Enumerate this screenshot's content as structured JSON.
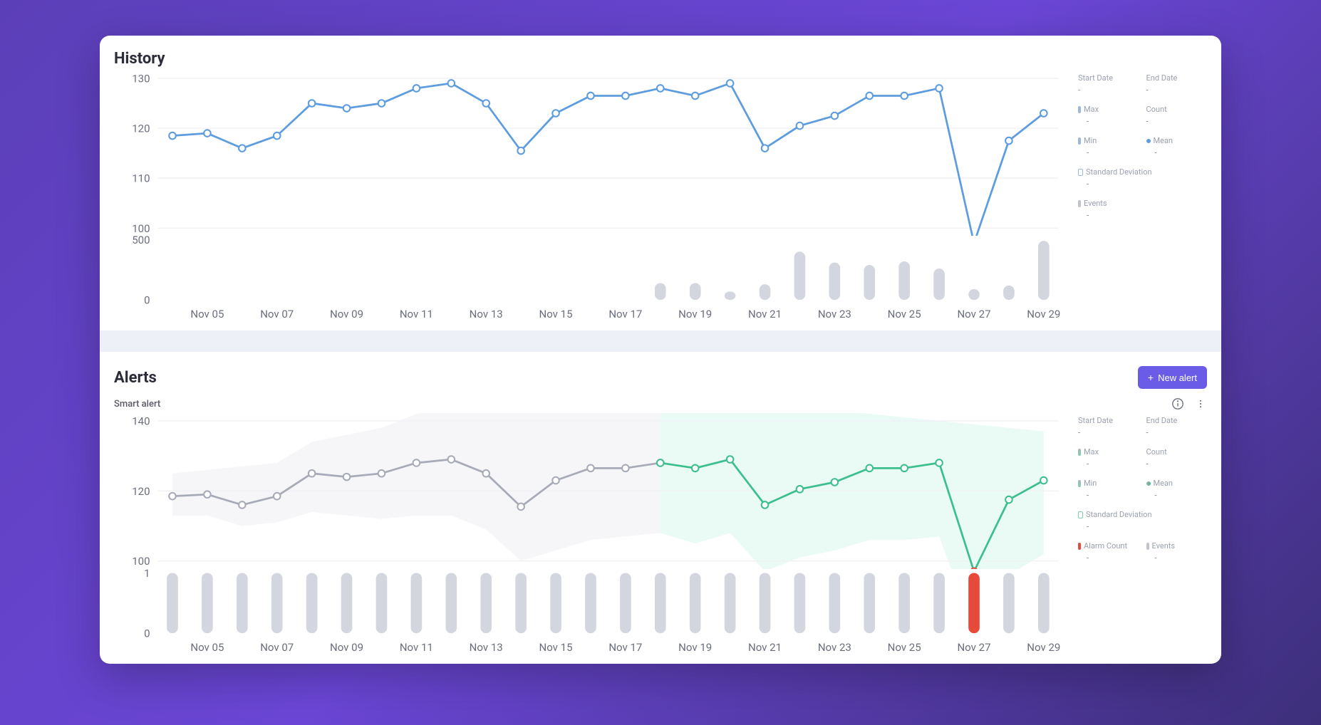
{
  "history": {
    "title": "History",
    "info": {
      "start_date": {
        "label": "Start Date",
        "value": "-"
      },
      "end_date": {
        "label": "End Date",
        "value": "-"
      },
      "max": {
        "label": "Max",
        "value": "-"
      },
      "count": {
        "label": "Count",
        "value": "-"
      },
      "min": {
        "label": "Min",
        "value": "-"
      },
      "mean": {
        "label": "Mean",
        "value": "-"
      },
      "std": {
        "label": "Standard Deviation",
        "value": "-"
      },
      "events": {
        "label": "Events",
        "value": "-"
      }
    }
  },
  "alerts": {
    "title": "Alerts",
    "new_alert_label": "New alert",
    "smart_alert_label": "Smart alert",
    "info": {
      "start_date": {
        "label": "Start Date",
        "value": "-"
      },
      "end_date": {
        "label": "End Date",
        "value": "-"
      },
      "max": {
        "label": "Max",
        "value": "-"
      },
      "count": {
        "label": "Count",
        "value": "-"
      },
      "min": {
        "label": "Min",
        "value": "-"
      },
      "mean": {
        "label": "Mean",
        "value": "-"
      },
      "std": {
        "label": "Standard Deviation",
        "value": "-"
      },
      "alarm_count": {
        "label": "Alarm Count",
        "value": "-"
      },
      "events": {
        "label": "Events",
        "value": "-"
      }
    }
  },
  "chart_data": [
    {
      "type": "line",
      "name": "history_line",
      "categories": [
        "Nov 04",
        "Nov 05",
        "Nov 06",
        "Nov 07",
        "Nov 08",
        "Nov 09",
        "Nov 10",
        "Nov 11",
        "Nov 12",
        "Nov 13",
        "Nov 14",
        "Nov 15",
        "Nov 16",
        "Nov 17",
        "Nov 18",
        "Nov 19",
        "Nov 20",
        "Nov 21",
        "Nov 22",
        "Nov 23",
        "Nov 24",
        "Nov 25",
        "Nov 26",
        "Nov 27",
        "Nov 28",
        "Nov 29"
      ],
      "x_tick_labels": [
        "Nov 05",
        "Nov 07",
        "Nov 09",
        "Nov 11",
        "Nov 13",
        "Nov 15",
        "Nov 17",
        "Nov 19",
        "Nov 21",
        "Nov 23",
        "Nov 25",
        "Nov 27",
        "Nov 29"
      ],
      "values": [
        118.5,
        119,
        116,
        118.5,
        125,
        124,
        125,
        128,
        129,
        125,
        115.5,
        123,
        126.5,
        126.5,
        128,
        126.5,
        129,
        116,
        120.5,
        122.5,
        126.5,
        126.5,
        128,
        97,
        117.5,
        123
      ],
      "ylim": [
        100,
        130
      ],
      "y_ticks": [
        100,
        110,
        120,
        130
      ],
      "color": "#5d9cde"
    },
    {
      "type": "bar",
      "name": "history_events",
      "categories": [
        "Nov 04",
        "Nov 05",
        "Nov 06",
        "Nov 07",
        "Nov 08",
        "Nov 09",
        "Nov 10",
        "Nov 11",
        "Nov 12",
        "Nov 13",
        "Nov 14",
        "Nov 15",
        "Nov 16",
        "Nov 17",
        "Nov 18",
        "Nov 19",
        "Nov 20",
        "Nov 21",
        "Nov 22",
        "Nov 23",
        "Nov 24",
        "Nov 25",
        "Nov 26",
        "Nov 27",
        "Nov 28",
        "Nov 29"
      ],
      "values": [
        0,
        0,
        0,
        0,
        0,
        0,
        0,
        0,
        0,
        0,
        0,
        0,
        0,
        0,
        140,
        140,
        70,
        130,
        400,
        310,
        290,
        320,
        260,
        90,
        120,
        490
      ],
      "ylim": [
        0,
        500
      ],
      "y_ticks": [
        0,
        500
      ],
      "color": "#d4d6df"
    },
    {
      "type": "line",
      "name": "alerts_line",
      "categories": [
        "Nov 04",
        "Nov 05",
        "Nov 06",
        "Nov 07",
        "Nov 08",
        "Nov 09",
        "Nov 10",
        "Nov 11",
        "Nov 12",
        "Nov 13",
        "Nov 14",
        "Nov 15",
        "Nov 16",
        "Nov 17",
        "Nov 18",
        "Nov 19",
        "Nov 20",
        "Nov 21",
        "Nov 22",
        "Nov 23",
        "Nov 24",
        "Nov 25",
        "Nov 26",
        "Nov 27",
        "Nov 28",
        "Nov 29"
      ],
      "x_tick_labels": [
        "Nov 05",
        "Nov 07",
        "Nov 09",
        "Nov 11",
        "Nov 13",
        "Nov 15",
        "Nov 17",
        "Nov 19",
        "Nov 21",
        "Nov 23",
        "Nov 25",
        "Nov 27",
        "Nov 29"
      ],
      "series": [
        {
          "name": "history",
          "color": "#a7abb7",
          "values": [
            118.5,
            119,
            116,
            118.5,
            125,
            124,
            125,
            128,
            129,
            125,
            115.5,
            123,
            126.5,
            126.5,
            128,
            null,
            null,
            null,
            null,
            null,
            null,
            null,
            null,
            null,
            null,
            null
          ]
        },
        {
          "name": "forecast",
          "color": "#3bbf8f",
          "values": [
            null,
            null,
            null,
            null,
            null,
            null,
            null,
            null,
            null,
            null,
            null,
            null,
            null,
            null,
            128,
            126.5,
            129,
            116,
            120.5,
            122.5,
            126.5,
            126.5,
            128,
            97,
            117.5,
            123
          ]
        }
      ],
      "band_upper": [
        125,
        126,
        127,
        128,
        134,
        136,
        138,
        142,
        144,
        146,
        146,
        147,
        147,
        147,
        147,
        146,
        146,
        145,
        144,
        143,
        142,
        141,
        140,
        139,
        138,
        137
      ],
      "band_lower": [
        113,
        113,
        110,
        111,
        114,
        113,
        112,
        113,
        113,
        109,
        100,
        103,
        106,
        107,
        108,
        105,
        108,
        97,
        101,
        103,
        106,
        106,
        107,
        80,
        96,
        102
      ],
      "alarm_indices": [
        23
      ],
      "ylim": [
        100,
        140
      ],
      "y_ticks": [
        100,
        120,
        140
      ]
    },
    {
      "type": "bar",
      "name": "alerts_events",
      "categories": [
        "Nov 04",
        "Nov 05",
        "Nov 06",
        "Nov 07",
        "Nov 08",
        "Nov 09",
        "Nov 10",
        "Nov 11",
        "Nov 12",
        "Nov 13",
        "Nov 14",
        "Nov 15",
        "Nov 16",
        "Nov 17",
        "Nov 18",
        "Nov 19",
        "Nov 20",
        "Nov 21",
        "Nov 22",
        "Nov 23",
        "Nov 24",
        "Nov 25",
        "Nov 26",
        "Nov 27",
        "Nov 28",
        "Nov 29"
      ],
      "values": [
        1,
        1,
        1,
        1,
        1,
        1,
        1,
        1,
        1,
        1,
        1,
        1,
        1,
        1,
        1,
        1,
        1,
        1,
        1,
        1,
        1,
        1,
        1,
        1,
        1,
        1
      ],
      "alarm_values": [
        0,
        0,
        0,
        0,
        0,
        0,
        0,
        0,
        0,
        0,
        0,
        0,
        0,
        0,
        0,
        0,
        0,
        0,
        0,
        0,
        0,
        0,
        0,
        1,
        0,
        0
      ],
      "ylim": [
        0,
        1
      ],
      "y_ticks": [
        0,
        1
      ],
      "color": "#d4d6df",
      "alarm_color": "#e64a3b"
    }
  ]
}
